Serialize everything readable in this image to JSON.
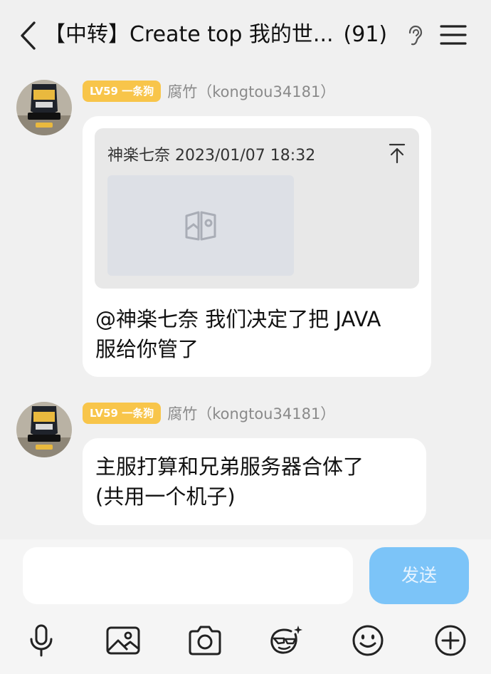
{
  "header": {
    "title": "【中转】Create top 我的世...",
    "member_count": "(91)",
    "icons": {
      "back": "chevron-left-icon",
      "ear": "ear-icon",
      "menu": "hamburger-menu-icon"
    }
  },
  "messages": [
    {
      "level_badge": "LV59 一条狗",
      "sender": "腐竹（kongtou34181）",
      "quote": {
        "header": "神楽七奈 2023/01/07 18:32",
        "image_placeholder_icon": "image-placeholder-icon"
      },
      "text_line1": "@神楽七奈 我们决定了把 JAVA",
      "text_line2": "服给你管了"
    },
    {
      "level_badge": "LV59 一条狗",
      "sender": "腐竹（kongtou34181）",
      "text_line1": "主服打算和兄弟服务器合体了",
      "text_line2": "(共用一个机子)"
    }
  ],
  "input": {
    "value": "",
    "send_label": "发送"
  },
  "toolbar": [
    "microphone-icon",
    "image-icon",
    "camera-icon",
    "sticker-icon",
    "emoji-icon",
    "plus-icon"
  ],
  "colors": {
    "badge": "#f8c54a",
    "send_button": "#7cc4f8",
    "background": "#f0f0f0"
  }
}
